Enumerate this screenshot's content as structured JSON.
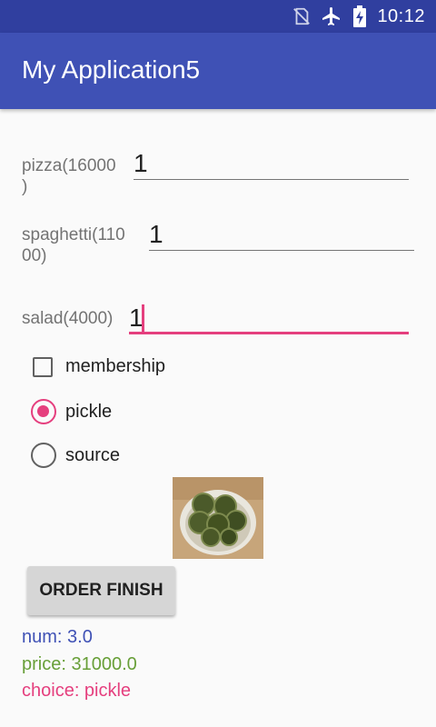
{
  "status_bar": {
    "time": "10:12",
    "icons": [
      "no-sim-icon",
      "airplane-mode-icon",
      "battery-charging-icon"
    ]
  },
  "app_bar": {
    "title": "My Application5",
    "color": "#3f51b5",
    "status_color": "#303f9f"
  },
  "form": {
    "pizza_label_line1": "pizza(16000",
    "pizza_label_line2": ")",
    "pizza_value": "1",
    "spaghetti_label_line1": "spaghetti(110",
    "spaghetti_label_line2": "00)",
    "spaghetti_value": "1",
    "salad_label": "salad(4000)",
    "salad_value": "1"
  },
  "options": {
    "membership_label": "membership",
    "membership_checked": false,
    "pickle_label": "pickle",
    "pickle_selected": true,
    "source_label": "source",
    "source_selected": false,
    "accent_color": "#e53f7e"
  },
  "image": {
    "icon": "pickle-photo"
  },
  "button": {
    "label": "ORDER FINISH"
  },
  "results": {
    "num": "num: 3.0",
    "price": "price: 31000.0",
    "choice": "choice: pickle",
    "num_color": "#3f51b5",
    "price_color": "#689f38",
    "choice_color": "#e53f7e"
  }
}
